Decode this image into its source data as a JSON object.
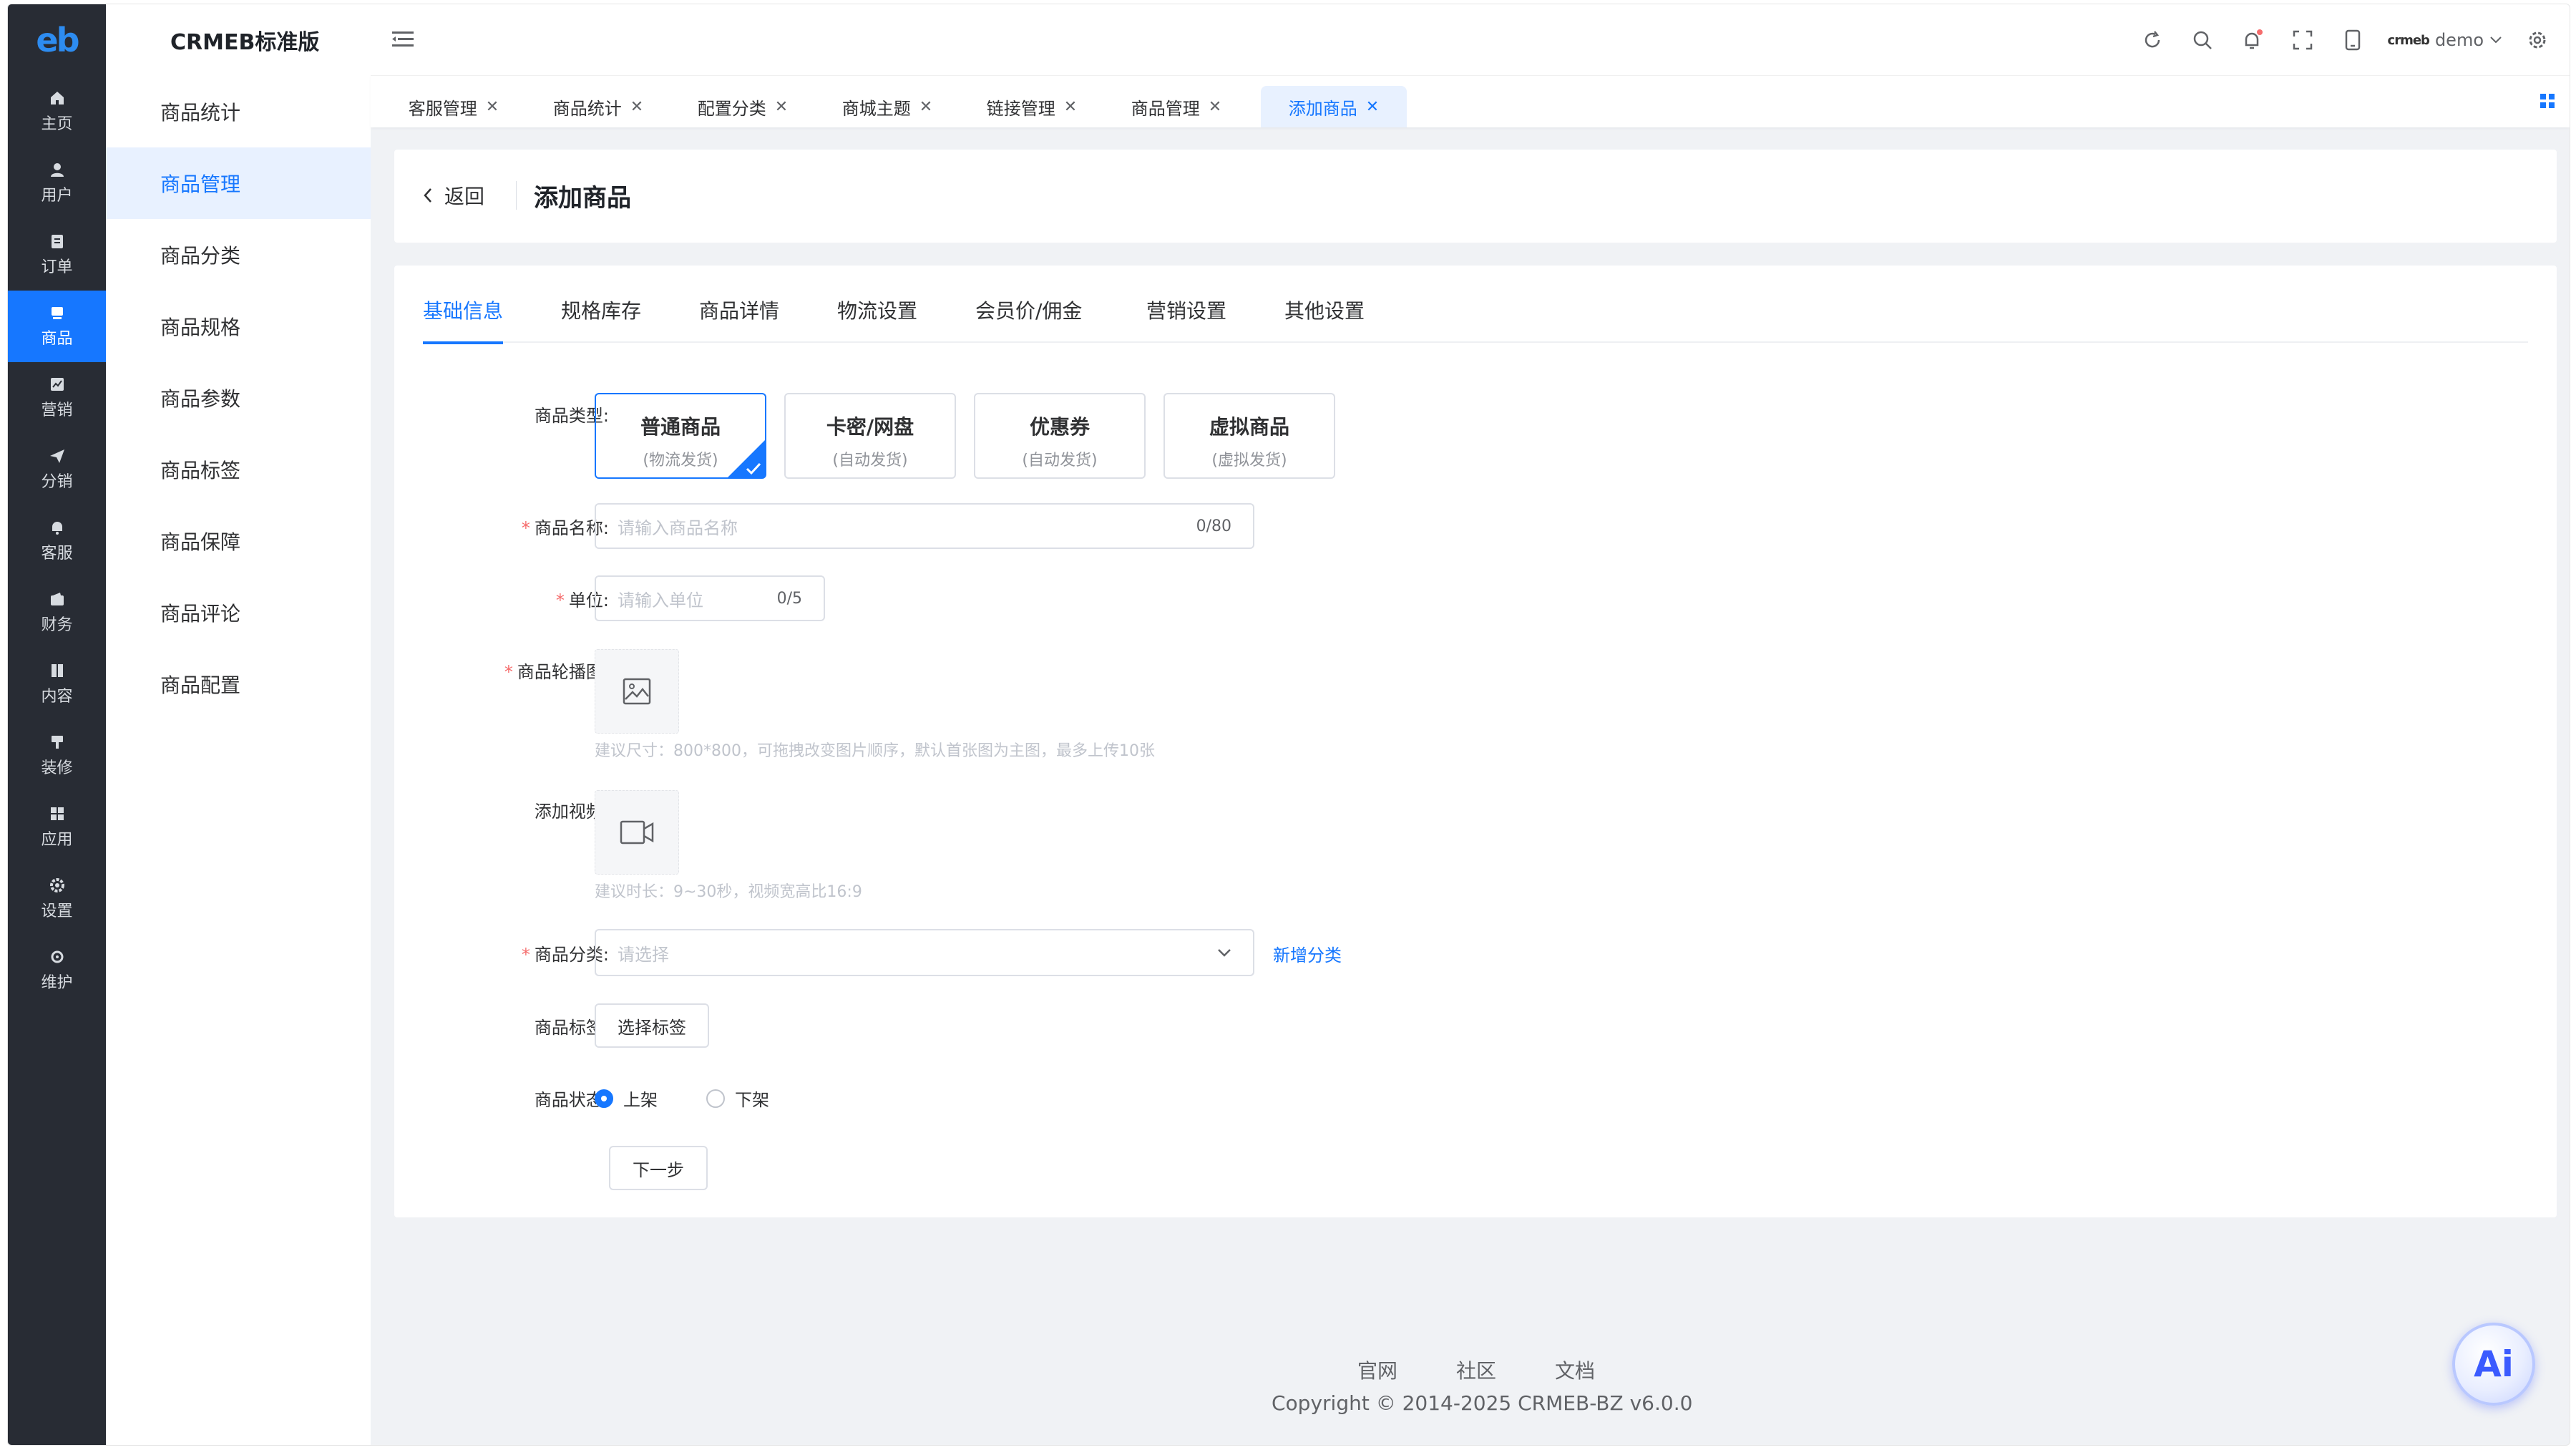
{
  "app": {
    "logo_text": "eb",
    "brand": "CRMEB标准版",
    "user": {
      "logo": "crmeb",
      "name": "demo"
    },
    "colors": {
      "primary": "#1677ff",
      "nav_bg": "#282c34",
      "required": "#f56c6c"
    }
  },
  "nav": [
    {
      "label": "主页",
      "icon": "home-icon"
    },
    {
      "label": "用户",
      "icon": "user-icon"
    },
    {
      "label": "订单",
      "icon": "order-icon"
    },
    {
      "label": "商品",
      "icon": "product-icon",
      "active": true
    },
    {
      "label": "营销",
      "icon": "marketing-icon"
    },
    {
      "label": "分销",
      "icon": "distribution-icon"
    },
    {
      "label": "客服",
      "icon": "service-icon"
    },
    {
      "label": "财务",
      "icon": "finance-icon"
    },
    {
      "label": "内容",
      "icon": "content-icon"
    },
    {
      "label": "装修",
      "icon": "decorate-icon"
    },
    {
      "label": "应用",
      "icon": "apps-icon"
    },
    {
      "label": "设置",
      "icon": "settings-icon"
    },
    {
      "label": "维护",
      "icon": "maintenance-icon"
    }
  ],
  "submenu": [
    "商品统计",
    "商品管理",
    "商品分类",
    "商品规格",
    "商品参数",
    "商品标签",
    "商品保障",
    "商品评论",
    "商品配置"
  ],
  "submenu_active": "商品管理",
  "tabs": [
    "客服管理",
    "商品统计",
    "配置分类",
    "商城主题",
    "链接管理",
    "商品管理",
    "添加商品"
  ],
  "active_tab": "添加商品",
  "page": {
    "back": "返回",
    "title": "添加商品"
  },
  "form_tabs": [
    "基础信息",
    "规格库存",
    "商品详情",
    "物流设置",
    "会员价/佣金",
    "营销设置",
    "其他设置"
  ],
  "form": {
    "type_label": "商品类型:",
    "types": [
      {
        "title": "普通商品",
        "sub": "(物流发货)"
      },
      {
        "title": "卡密/网盘",
        "sub": "(自动发货)"
      },
      {
        "title": "优惠券",
        "sub": "(自动发货)"
      },
      {
        "title": "虚拟商品",
        "sub": "(虚拟发货)"
      }
    ],
    "name_label": "商品名称:",
    "name_placeholder": "请输入商品名称",
    "name_count": "0/80",
    "unit_label": "单位:",
    "unit_placeholder": "请输入单位",
    "unit_count": "0/5",
    "images_label": "商品轮播图:",
    "images_hint": "建议尺寸：800*800，可拖拽改变图片顺序，默认首张图为主图，最多上传10张",
    "video_label": "添加视频:",
    "video_hint": "建议时长：9~30秒，视频宽高比16:9",
    "category_label": "商品分类:",
    "category_placeholder": "请选择",
    "add_category": "新增分类",
    "tags_label": "商品标签:",
    "tags_button": "选择标签",
    "status_label": "商品状态:",
    "status_on": "上架",
    "status_off": "下架",
    "next": "下一步"
  },
  "footer": {
    "links": [
      "官网",
      "社区",
      "文档"
    ],
    "copyright": "Copyright © 2014-2025 CRMEB-BZ v6.0.0"
  },
  "ai_label": "Ai"
}
